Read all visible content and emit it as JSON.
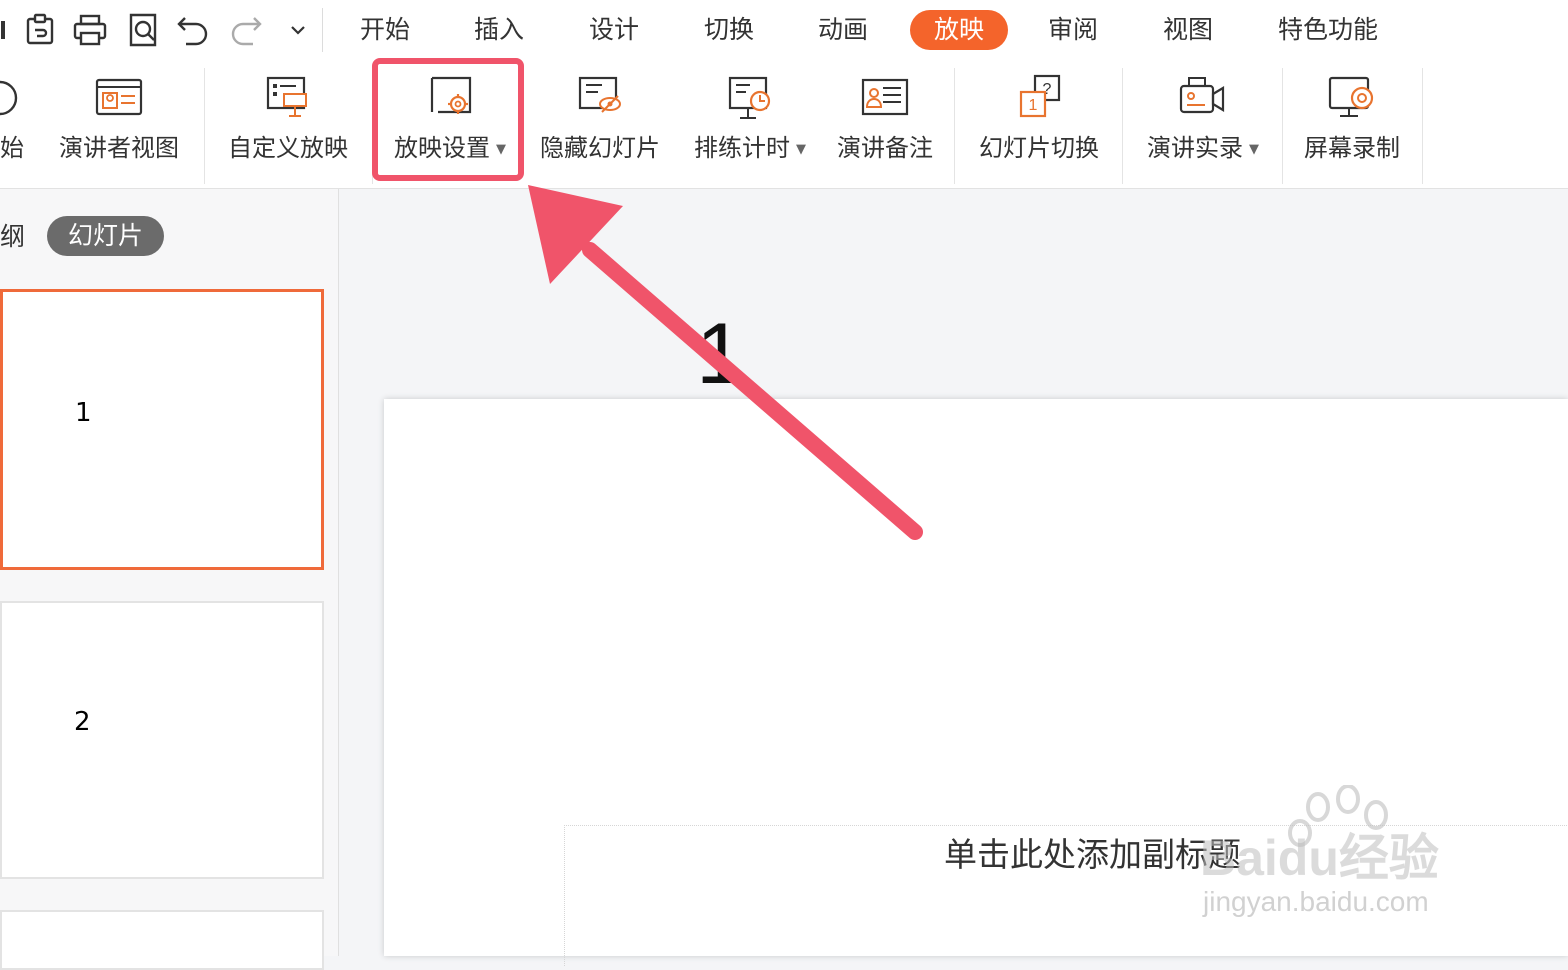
{
  "quick_access": {
    "icons": [
      "clipboard-icon",
      "print-icon",
      "print-preview-icon",
      "undo-icon",
      "redo-icon",
      "customize-dropdown-icon"
    ]
  },
  "tabs": [
    {
      "label": "开始",
      "active": false
    },
    {
      "label": "插入",
      "active": false
    },
    {
      "label": "设计",
      "active": false
    },
    {
      "label": "切换",
      "active": false
    },
    {
      "label": "动画",
      "active": false
    },
    {
      "label": "放映",
      "active": true
    },
    {
      "label": "审阅",
      "active": false
    },
    {
      "label": "视图",
      "active": false
    },
    {
      "label": "特色功能",
      "active": false
    }
  ],
  "ribbon": {
    "from_start_label": "开始",
    "presenter_view_label": "演讲者视图",
    "custom_show_label": "自定义放映",
    "show_settings_label": "放映设置",
    "hide_slide_label": "隐藏幻灯片",
    "rehearse_timing_label": "排练计时",
    "speaker_notes_label": "演讲备注",
    "slide_transition_label": "幻灯片切换",
    "record_presentation_label": "演讲实录",
    "screen_record_label": "屏幕录制"
  },
  "left_panel": {
    "outline_tab": "纲",
    "slides_tab": "幻灯片",
    "thumbnails": [
      "1",
      "2"
    ]
  },
  "slide": {
    "title": "1",
    "subtitle_placeholder": "单击此处添加副标题"
  },
  "watermark": {
    "brand": "Baidu经验",
    "url": "jingyan.baidu.com"
  },
  "colors": {
    "accent": "#f4642b",
    "annotation": "#f0546a",
    "icon_orange": "#e8742f"
  }
}
